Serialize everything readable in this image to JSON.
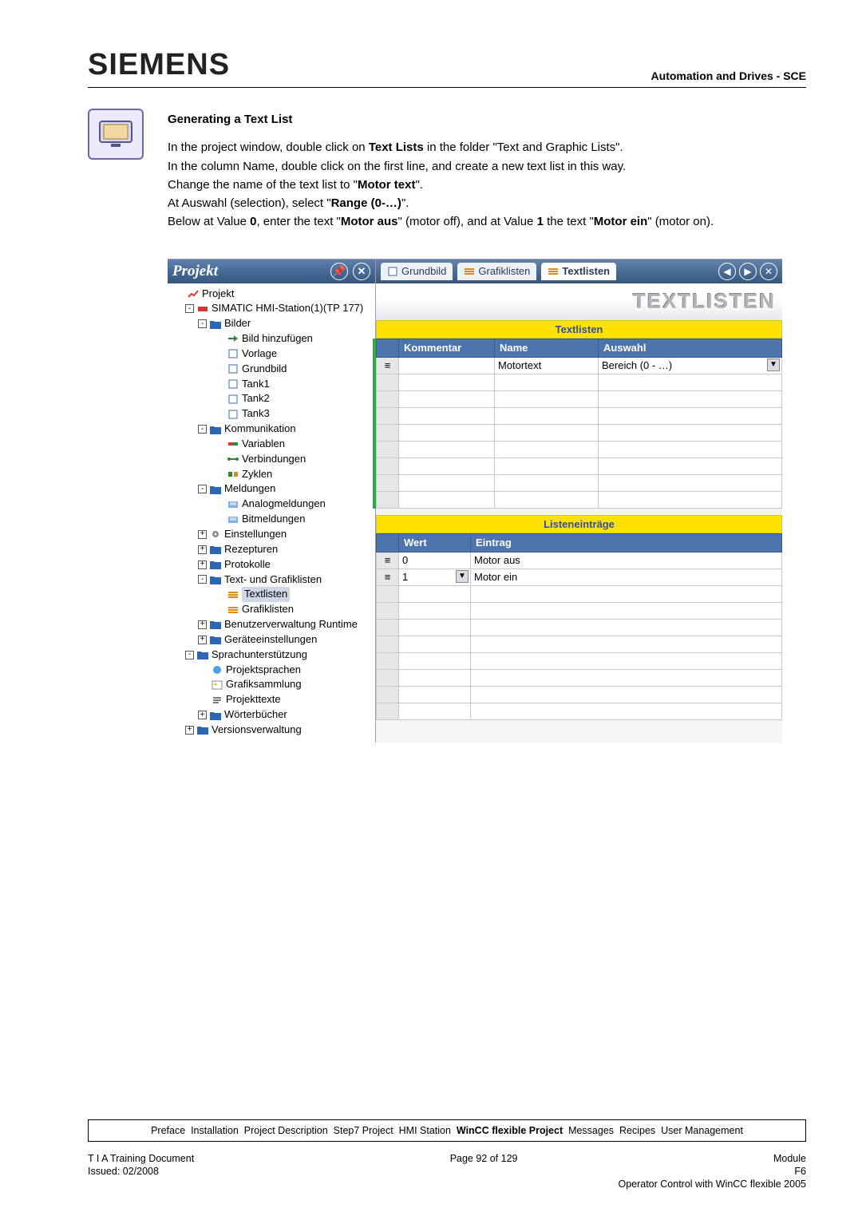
{
  "header": {
    "brand": "SIEMENS",
    "right": "Automation and Drives - SCE"
  },
  "section_title": "Generating a Text List",
  "instruction_lines": [
    "In the project window, double click on <b>Text Lists</b> in the folder \"Text and Graphic Lists\".",
    "In the column Name, double click on the first line, and create a new text list in this way.",
    "Change the name of the text list to \"<b>Motor text</b>\".",
    "At Auswahl (selection), select \"<b>Range (0-…)</b>\".",
    "Below at Value <b>0</b>, enter the text \"<b>Motor aus</b>\" (motor off), and at Value <b>1</b> the text \"<b>Motor ein</b>\" (motor on)."
  ],
  "project_panel": {
    "title": "Projekt",
    "tree": [
      {
        "level": 0,
        "twisty": "",
        "icon": "chart",
        "label": "Projekt"
      },
      {
        "level": 1,
        "twisty": "-",
        "icon": "dev",
        "label": "SIMATIC HMI-Station(1)(TP 177)"
      },
      {
        "level": 2,
        "twisty": "-",
        "icon": "folder",
        "label": "Bilder"
      },
      {
        "level": 3,
        "twisty": "",
        "icon": "arrow",
        "label": "Bild hinzufügen"
      },
      {
        "level": 3,
        "twisty": "",
        "icon": "page",
        "label": "Vorlage"
      },
      {
        "level": 3,
        "twisty": "",
        "icon": "page",
        "label": "Grundbild"
      },
      {
        "level": 3,
        "twisty": "",
        "icon": "page",
        "label": "Tank1"
      },
      {
        "level": 3,
        "twisty": "",
        "icon": "page",
        "label": "Tank2"
      },
      {
        "level": 3,
        "twisty": "",
        "icon": "page",
        "label": "Tank3"
      },
      {
        "level": 2,
        "twisty": "-",
        "icon": "folder",
        "label": "Kommunikation"
      },
      {
        "level": 3,
        "twisty": "",
        "icon": "tag",
        "label": "Variablen"
      },
      {
        "level": 3,
        "twisty": "",
        "icon": "conn",
        "label": "Verbindungen"
      },
      {
        "level": 3,
        "twisty": "",
        "icon": "cycle",
        "label": "Zyklen"
      },
      {
        "level": 2,
        "twisty": "-",
        "icon": "folder",
        "label": "Meldungen"
      },
      {
        "level": 3,
        "twisty": "",
        "icon": "msg",
        "label": "Analogmeldungen"
      },
      {
        "level": 3,
        "twisty": "",
        "icon": "msg",
        "label": "Bitmeldungen"
      },
      {
        "level": 2,
        "twisty": "+",
        "icon": "gear",
        "label": "Einstellungen"
      },
      {
        "level": 2,
        "twisty": "+",
        "icon": "folder",
        "label": "Rezepturen"
      },
      {
        "level": 2,
        "twisty": "+",
        "icon": "folder",
        "label": "Protokolle"
      },
      {
        "level": 2,
        "twisty": "-",
        "icon": "folder",
        "label": "Text- und Grafiklisten"
      },
      {
        "level": 3,
        "twisty": "",
        "icon": "list",
        "label": "Textlisten",
        "selected": true
      },
      {
        "level": 3,
        "twisty": "",
        "icon": "list",
        "label": "Grafiklisten"
      },
      {
        "level": 2,
        "twisty": "+",
        "icon": "folder",
        "label": "Benutzerverwaltung Runtime"
      },
      {
        "level": 2,
        "twisty": "+",
        "icon": "folder",
        "label": "Geräteeinstellungen"
      },
      {
        "level": 1,
        "twisty": "-",
        "icon": "folder",
        "label": "Sprachunterstützung"
      },
      {
        "level": 2,
        "twisty": "",
        "icon": "globe",
        "label": "Projektsprachen"
      },
      {
        "level": 2,
        "twisty": "",
        "icon": "pic",
        "label": "Grafiksammlung"
      },
      {
        "level": 2,
        "twisty": "",
        "icon": "text",
        "label": "Projekttexte"
      },
      {
        "level": 2,
        "twisty": "+",
        "icon": "folder",
        "label": "Wörterbücher"
      },
      {
        "level": 1,
        "twisty": "+",
        "icon": "folder",
        "label": "Versionsverwaltung"
      }
    ]
  },
  "tabs": [
    {
      "label": "Grundbild",
      "active": false,
      "icon": "page"
    },
    {
      "label": "Grafiklisten",
      "active": false,
      "icon": "list"
    },
    {
      "label": "Textlisten",
      "active": true,
      "icon": "list"
    }
  ],
  "banner": "TEXTLISTEN",
  "textlisten": {
    "head": "Textlisten",
    "columns": [
      "Kommentar",
      "Name",
      "Auswahl"
    ],
    "rows": [
      {
        "kommentar": "",
        "name": "Motortext",
        "auswahl": "Bereich (0 - …)"
      }
    ],
    "blank_rows": 8
  },
  "listeneintraege": {
    "head": "Listeneinträge",
    "columns": [
      "Wert",
      "Eintrag"
    ],
    "rows": [
      {
        "wert": "0",
        "eintrag": "Motor aus"
      },
      {
        "wert": "1",
        "eintrag": "Motor ein"
      }
    ],
    "blank_rows": 8
  },
  "footer": {
    "breadcrumb": [
      "Preface",
      "Installation",
      "Project Description",
      "Step7 Project",
      "HMI Station",
      "WinCC flexible Project",
      "Messages",
      "Recipes",
      "User Management"
    ],
    "current_crumb_index": 5,
    "row1_left": "T I A  Training Document",
    "row1_center": "Page 92 of 129",
    "row1_right": "Module",
    "row2_left": "Issued: 02/2008",
    "row2_right_top": "F6",
    "row2_right_bottom": "Operator Control with WinCC flexible 2005"
  }
}
